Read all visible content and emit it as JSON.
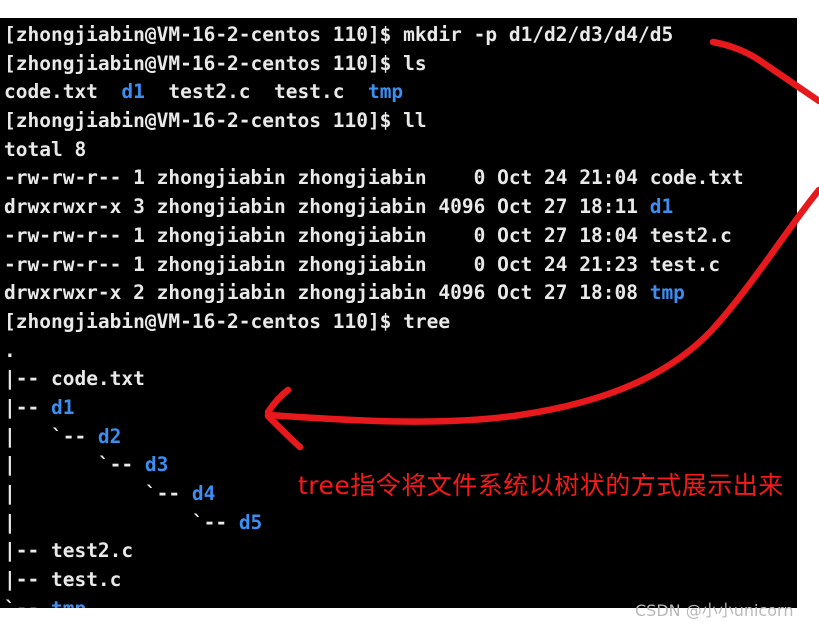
{
  "terminal": {
    "prompt": "[zhongjiabin@VM-16-2-centos 110]$ ",
    "user": "zhongjiabin",
    "host": "VM-16-2-centos",
    "cwd_label": "110",
    "colors": {
      "background": "#000000",
      "foreground": "#e9e9e9",
      "directory": "#3c8ef0",
      "annotation": "#f5191b",
      "watermark": "#b9b9b9"
    },
    "lines": [
      {
        "id": "l01",
        "type": "command",
        "prompt": "[zhongjiabin@VM-16-2-centos 110]$ ",
        "command": "mkdir -p d1/d2/d3/d4/d5"
      },
      {
        "id": "l02",
        "type": "command",
        "prompt": "[zhongjiabin@VM-16-2-centos 110]$ ",
        "command": "ls"
      },
      {
        "id": "l03",
        "type": "ls-output",
        "parts": [
          {
            "text": "code.txt  ",
            "color": "white"
          },
          {
            "text": "d1",
            "color": "dir"
          },
          {
            "text": "  test2.c  test.c  ",
            "color": "white"
          },
          {
            "text": "tmp",
            "color": "dir"
          }
        ]
      },
      {
        "id": "l04",
        "type": "command",
        "prompt": "[zhongjiabin@VM-16-2-centos 110]$ ",
        "command": "ll"
      },
      {
        "id": "l05",
        "type": "output",
        "parts": [
          {
            "text": "total 8",
            "color": "white"
          }
        ]
      },
      {
        "id": "l06",
        "type": "ll-row",
        "parts": [
          {
            "text": "-rw-rw-r-- 1 zhongjiabin zhongjiabin    0 Oct 24 21:04 ",
            "color": "white"
          },
          {
            "text": "code.txt",
            "color": "white"
          }
        ]
      },
      {
        "id": "l07",
        "type": "ll-row",
        "parts": [
          {
            "text": "drwxrwxr-x 3 zhongjiabin zhongjiabin 4096 Oct 27 18:11 ",
            "color": "white"
          },
          {
            "text": "d1",
            "color": "dir"
          }
        ]
      },
      {
        "id": "l08",
        "type": "ll-row",
        "parts": [
          {
            "text": "-rw-rw-r-- 1 zhongjiabin zhongjiabin    0 Oct 27 18:04 ",
            "color": "white"
          },
          {
            "text": "test2.c",
            "color": "white"
          }
        ]
      },
      {
        "id": "l09",
        "type": "ll-row",
        "parts": [
          {
            "text": "-rw-rw-r-- 1 zhongjiabin zhongjiabin    0 Oct 24 21:23 ",
            "color": "white"
          },
          {
            "text": "test.c",
            "color": "white"
          }
        ]
      },
      {
        "id": "l10",
        "type": "ll-row",
        "parts": [
          {
            "text": "drwxrwxr-x 2 zhongjiabin zhongjiabin 4096 Oct 27 18:08 ",
            "color": "white"
          },
          {
            "text": "tmp",
            "color": "dir"
          }
        ]
      },
      {
        "id": "l11",
        "type": "command",
        "prompt": "[zhongjiabin@VM-16-2-centos 110]$ ",
        "command": "tree"
      },
      {
        "id": "l12",
        "type": "tree",
        "parts": [
          {
            "text": ".",
            "color": "white"
          }
        ]
      },
      {
        "id": "l13",
        "type": "tree",
        "parts": [
          {
            "text": "|-- ",
            "color": "white"
          },
          {
            "text": "code.txt",
            "color": "white"
          }
        ]
      },
      {
        "id": "l14",
        "type": "tree",
        "parts": [
          {
            "text": "|-- ",
            "color": "white"
          },
          {
            "text": "d1",
            "color": "dir"
          }
        ]
      },
      {
        "id": "l15",
        "type": "tree",
        "parts": [
          {
            "text": "|   `-- ",
            "color": "white"
          },
          {
            "text": "d2",
            "color": "dir"
          }
        ]
      },
      {
        "id": "l16",
        "type": "tree",
        "parts": [
          {
            "text": "|       `-- ",
            "color": "white"
          },
          {
            "text": "d3",
            "color": "dir"
          }
        ]
      },
      {
        "id": "l17",
        "type": "tree",
        "parts": [
          {
            "text": "|           `-- ",
            "color": "white"
          },
          {
            "text": "d4",
            "color": "dir"
          }
        ]
      },
      {
        "id": "l18",
        "type": "tree",
        "parts": [
          {
            "text": "|               `-- ",
            "color": "white"
          },
          {
            "text": "d5",
            "color": "dir"
          }
        ]
      },
      {
        "id": "l19",
        "type": "tree",
        "parts": [
          {
            "text": "|-- ",
            "color": "white"
          },
          {
            "text": "test2.c",
            "color": "white"
          }
        ]
      },
      {
        "id": "l20",
        "type": "tree",
        "parts": [
          {
            "text": "|-- ",
            "color": "white"
          },
          {
            "text": "test.c",
            "color": "white"
          }
        ]
      },
      {
        "id": "l21",
        "type": "tree",
        "parts": [
          {
            "text": "`-- ",
            "color": "white"
          },
          {
            "text": "tmp",
            "color": "dir"
          }
        ]
      }
    ]
  },
  "annotation": {
    "note": "tree指令将文件系统以树状的方式展示出来",
    "color": "#f5191b"
  },
  "watermark": {
    "text": "CSDN @小小unicorn"
  }
}
